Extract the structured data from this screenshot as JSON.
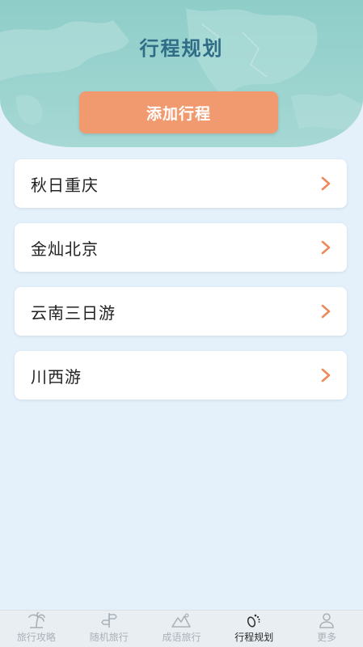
{
  "header": {
    "title": "行程规划",
    "add_button_label": "添加行程"
  },
  "trips": [
    {
      "name": "秋日重庆"
    },
    {
      "name": "金灿北京"
    },
    {
      "name": "云南三日游"
    },
    {
      "name": "川西游"
    }
  ],
  "tabbar": {
    "tabs": [
      {
        "label": "旅行攻略",
        "icon": "palm-tree-icon",
        "active": false
      },
      {
        "label": "随机旅行",
        "icon": "signpost-icon",
        "active": false
      },
      {
        "label": "成语旅行",
        "icon": "mountain-icon",
        "active": false
      },
      {
        "label": "行程规划",
        "icon": "footprint-icon",
        "active": true
      },
      {
        "label": "更多",
        "icon": "person-icon",
        "active": false
      }
    ]
  },
  "colors": {
    "header_bg": "#9bd3cf",
    "title": "#2f6d86",
    "accent": "#f29a6f",
    "page_bg": "#e4f0fa",
    "chevron": "#ec8a5c",
    "tab_inactive": "#a9b1b8",
    "tab_active": "#2b2b2b"
  }
}
